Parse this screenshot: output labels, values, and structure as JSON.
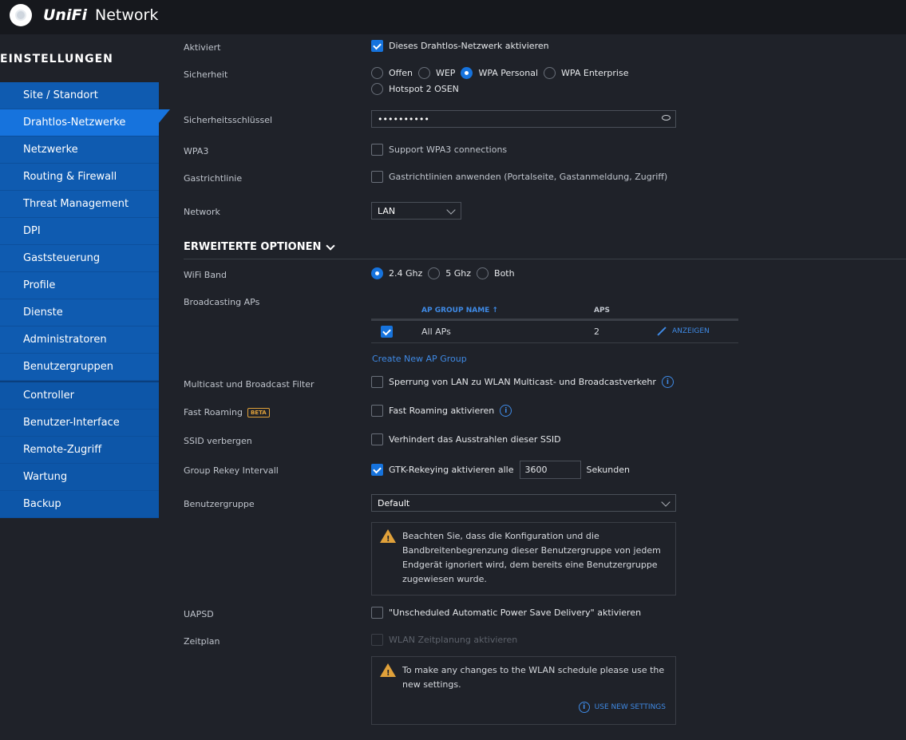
{
  "app": {
    "brand_unifi": "UniFi",
    "brand_network": "Network"
  },
  "sidebar": {
    "title": "EINSTELLUNGEN",
    "items": [
      {
        "label": "Site / Standort"
      },
      {
        "label": "Drahtlos-Netzwerke",
        "active": true
      },
      {
        "label": "Netzwerke"
      },
      {
        "label": "Routing & Firewall"
      },
      {
        "label": "Threat Management"
      },
      {
        "label": "DPI"
      },
      {
        "label": "Gaststeuerung"
      },
      {
        "label": "Profile"
      },
      {
        "label": "Dienste"
      },
      {
        "label": "Administratoren"
      },
      {
        "label": "Benutzergruppen"
      }
    ],
    "items2": [
      {
        "label": "Controller"
      },
      {
        "label": "Benutzer-Interface"
      },
      {
        "label": "Remote-Zugriff"
      },
      {
        "label": "Wartung"
      },
      {
        "label": "Backup"
      }
    ]
  },
  "form": {
    "aktiviert": {
      "label": "Aktiviert",
      "option": "Dieses Drahtlos-Netzwerk aktivieren",
      "checked": true
    },
    "sicherheit": {
      "label": "Sicherheit",
      "options": [
        "Offen",
        "WEP",
        "WPA Personal",
        "WPA Enterprise",
        "Hotspot 2 OSEN"
      ],
      "selected": "WPA Personal"
    },
    "key": {
      "label": "Sicherheitsschlüssel",
      "value": "••••••••••"
    },
    "wpa3": {
      "label": "WPA3",
      "option": "Support WPA3 connections"
    },
    "guest": {
      "label": "Gastrichtlinie",
      "option": "Gastrichtlinien anwenden (Portalseite, Gastanmeldung, Zugriff)"
    },
    "network": {
      "label": "Network",
      "value": "LAN"
    },
    "advanced_title": "ERWEITERTE OPTIONEN",
    "wifiband": {
      "label": "WiFi Band",
      "options": [
        "2.4 Ghz",
        "5 Ghz",
        "Both"
      ],
      "selected": "2.4 Ghz"
    },
    "broadcasting": {
      "label": "Broadcasting APs",
      "col_name": "AP GROUP NAME ↑",
      "col_aps": "APS",
      "row_name": "All APs",
      "row_aps": "2",
      "row_action": "ANZEIGEN",
      "create_link": "Create New AP Group"
    },
    "multicast": {
      "label": "Multicast und Broadcast Filter",
      "option": "Sperrung von LAN zu WLAN Multicast- und Broadcastverkehr"
    },
    "fastroaming": {
      "label": "Fast Roaming",
      "badge": "BETA",
      "option": "Fast Roaming aktivieren"
    },
    "ssid": {
      "label": "SSID verbergen",
      "option": "Verhindert das Ausstrahlen dieser SSID"
    },
    "rekey": {
      "label": "Group Rekey Intervall",
      "option": "GTK-Rekeying aktivieren alle",
      "value": "3600",
      "unit": "Sekunden"
    },
    "usergroup": {
      "label": "Benutzergruppe",
      "value": "Default",
      "warning": "Beachten Sie, dass die Konfiguration und die Bandbreitenbegrenzung dieser Benutzergruppe von jedem Endgerät ignoriert wird, dem bereits eine Benutzergruppe zugewiesen wurde."
    },
    "uapsd": {
      "label": "UAPSD",
      "option": "\"Unscheduled Automatic Power Save Delivery\" aktivieren"
    },
    "schedule": {
      "label": "Zeitplan",
      "option": "WLAN Zeitplanung aktivieren",
      "warning": "To make any changes to the WLAN schedule please use the new settings.",
      "link": "USE NEW SETTINGS"
    }
  },
  "colors": {
    "accent": "#1673dd",
    "warning": "#e0a13a",
    "background": "#1f2229"
  }
}
